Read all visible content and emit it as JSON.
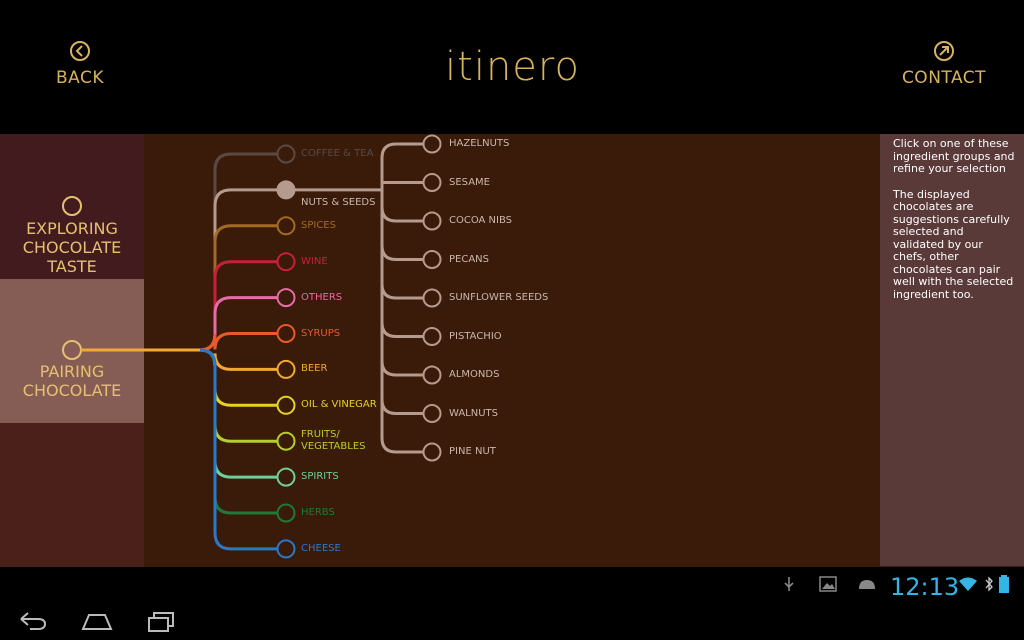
{
  "header": {
    "back_label": "BACK",
    "logo_text": "itinero",
    "contact_label": "CONTACT",
    "accent": "#d9b25f"
  },
  "sidebar": {
    "explore_label": "EXPLORING\nCHOCOLATE TASTE",
    "pairing_label": "PAIRING\nCHOCOLATE"
  },
  "categories": [
    {
      "label": "COFFEE & TEA",
      "color": "#5a4a44",
      "selected": false
    },
    {
      "label": "NUTS & SEEDS",
      "color": "#b59a8e",
      "selected": true
    },
    {
      "label": "SPICES",
      "color": "#a36a24",
      "selected": false
    },
    {
      "label": "WINE",
      "color": "#c8203c",
      "selected": false
    },
    {
      "label": "OTHERS",
      "color": "#e86aa8",
      "selected": false
    },
    {
      "label": "SYRUPS",
      "color": "#e85a2a",
      "selected": false
    },
    {
      "label": "BEER",
      "color": "#f2a930",
      "selected": false
    },
    {
      "label": "OIL & VINEGAR",
      "color": "#e5d225",
      "selected": false
    },
    {
      "label": "FRUITS/\nVEGETABLES",
      "color": "#b5cf2c",
      "selected": false
    },
    {
      "label": "SPIRITS",
      "color": "#6fcf9a",
      "selected": false
    },
    {
      "label": "HERBS",
      "color": "#1e7a38",
      "selected": false
    },
    {
      "label": "CHEESE",
      "color": "#2a78c8",
      "selected": false
    }
  ],
  "ingredients": [
    "HAZELNUTS",
    "SESAME",
    "COCOA NIBS",
    "PECANS",
    "SUNFLOWER SEEDS",
    "PISTACHIO",
    "ALMONDS",
    "WALNUTS",
    "PINE NUT"
  ],
  "info": {
    "paragraph1": "Click on one of these ingredient groups and refine your selection",
    "paragraph2": "The displayed chocolates are suggestions carefully selected and validated by our chefs, other chocolates can pair well with the selected ingredient too."
  },
  "status": {
    "time": "12:13",
    "time_color": "#33b5e5"
  }
}
